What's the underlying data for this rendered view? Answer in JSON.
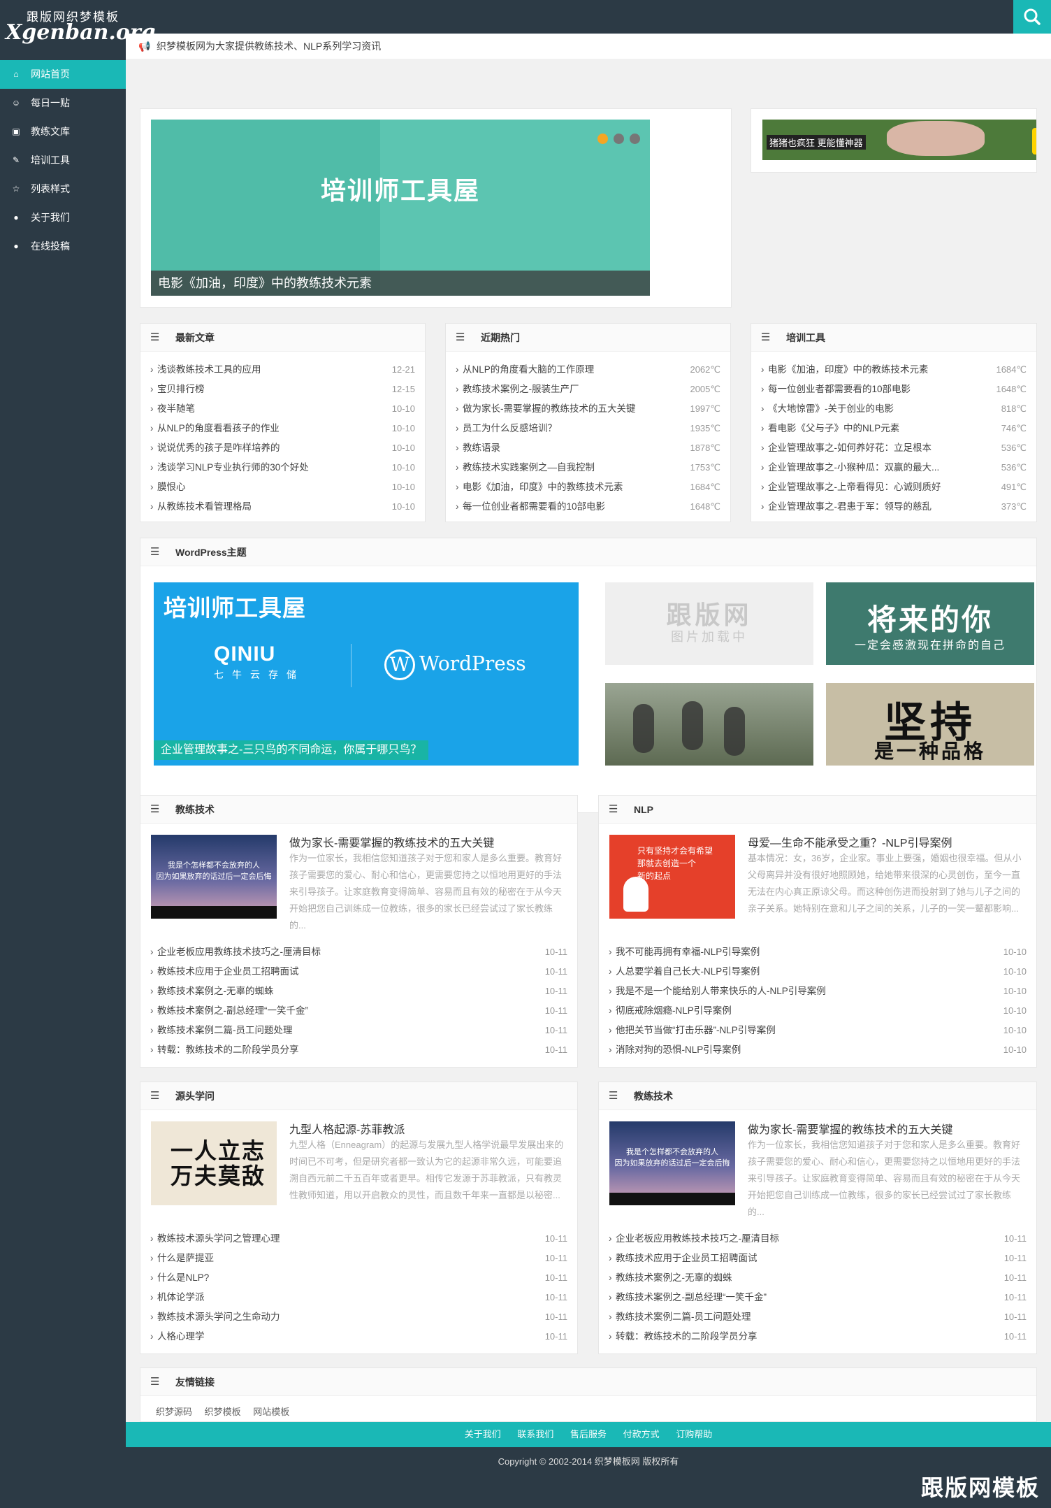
{
  "site": {
    "logo_top": "跟版网织梦模板",
    "logo_main": "Xgenban.org",
    "notice": "织梦模板网为大家提供教练技术、NLP系列学习资讯",
    "watermark": "跟版网模板"
  },
  "nav": [
    {
      "label": "网站首页",
      "icon": "home-icon",
      "active": true
    },
    {
      "label": "每日一贴",
      "icon": "smile-icon"
    },
    {
      "label": "教练文库",
      "icon": "image-icon"
    },
    {
      "label": "培训工具",
      "icon": "pencil-icon"
    },
    {
      "label": "列表样式",
      "icon": "star-icon"
    },
    {
      "label": "关于我们",
      "icon": "chat-icon"
    },
    {
      "label": "在线投稿",
      "icon": "chat-icon"
    }
  ],
  "slider": {
    "title": "培训师工具屋",
    "caption": "电影《加油，印度》中的教练技术元素"
  },
  "ad": {
    "text": "猪猪也疯狂 更能懂神器"
  },
  "lists": [
    {
      "title": "最新文章",
      "items": [
        {
          "t": "浅谈教练技术工具的应用",
          "d": "12-21"
        },
        {
          "t": "宝贝排行榜",
          "d": "12-15"
        },
        {
          "t": "夜半随笔",
          "d": "10-10"
        },
        {
          "t": "从NLP的角度看看孩子的作业",
          "d": "10-10"
        },
        {
          "t": "说说优秀的孩子是咋样培养的",
          "d": "10-10"
        },
        {
          "t": "浅谈学习NLP专业执行师的30个好处",
          "d": "10-10"
        },
        {
          "t": "膜恨心",
          "d": "10-10"
        },
        {
          "t": "从教练技术看管理格局",
          "d": "10-10"
        }
      ]
    },
    {
      "title": "近期热门",
      "items": [
        {
          "t": "从NLP的角度看大脑的工作原理",
          "d": "2062℃"
        },
        {
          "t": "教练技术案例之-服装生产厂",
          "d": "2005℃"
        },
        {
          "t": "做为家长-需要掌握的教练技术的五大关键",
          "d": "1997℃"
        },
        {
          "t": "员工为什么反感培训？",
          "d": "1935℃"
        },
        {
          "t": "教练语录",
          "d": "1878℃"
        },
        {
          "t": "教练技术实践案例之—自我控制",
          "d": "1753℃"
        },
        {
          "t": "电影《加油，印度》中的教练技术元素",
          "d": "1684℃"
        },
        {
          "t": "每一位创业者都需要看的10部电影",
          "d": "1648℃"
        }
      ]
    },
    {
      "title": "培训工具",
      "items": [
        {
          "t": "电影《加油，印度》中的教练技术元素",
          "d": "1684℃"
        },
        {
          "t": "每一位创业者都需要看的10部电影",
          "d": "1648℃"
        },
        {
          "t": "《大地惊雷》-关于创业的电影",
          "d": "818℃"
        },
        {
          "t": "看电影《父与子》中的NLP元素",
          "d": "746℃"
        },
        {
          "t": "企业管理故事之-如何养好花：立足根本",
          "d": "536℃"
        },
        {
          "t": "企业管理故事之-小猴种瓜：双赢的最大...",
          "d": "536℃"
        },
        {
          "t": "企业管理故事之-上帝看得见：心诚则质好",
          "d": "491℃"
        },
        {
          "t": "企业管理故事之-君患于军：领导的慈乱",
          "d": "373℃"
        }
      ]
    }
  ],
  "wordpress": {
    "title": "WordPress主题",
    "big_title": "培训师工具屋",
    "qiniu": "QINIU",
    "qiniu_sub": "七牛云存储",
    "wp_label": "WordPress",
    "caption": "企业管理故事之-三只鸟的不同命运，你属于哪只鸟？",
    "thumb1_big": "跟版网",
    "thumb1_small": "图片加载中",
    "thumb2_big": "将来的你",
    "thumb2_small": "一定会感激现在拼命的自己",
    "thumb4_big": "坚持",
    "thumb4_small": "是一种品格"
  },
  "sections": [
    {
      "title": "教练技术",
      "img": "sky",
      "img_text": "我是个怎样都不会放弃的人\n因为如果放弃的话过后一定会后悔",
      "feature_title": "做为家长-需要掌握的教练技术的五大关键",
      "feature_desc": "作为一位家长，我相信您知道孩子对于您和家人是多么重要。教育好孩子需要您的爱心、耐心和信心，更需要您持之以恒地用更好的手法来引导孩子。让家庭教育变得简单、容易而且有效的秘密在于从今天开始把您自己训练成一位教练，很多的家长已经尝试过了家长教练的...",
      "items": [
        {
          "t": "企业老板应用教练技术技巧之-厘清目标",
          "d": "10-11"
        },
        {
          "t": "教练技术应用于企业员工招聘面试",
          "d": "10-11"
        },
        {
          "t": "教练技术案例之-无辜的蜘蛛",
          "d": "10-11"
        },
        {
          "t": "教练技术案例之-副总经理“一笑千金”",
          "d": "10-11"
        },
        {
          "t": "教练技术案例二篇-员工问题处理",
          "d": "10-11"
        },
        {
          "t": "转载：教练技术的二阶段学员分享",
          "d": "10-11"
        }
      ]
    },
    {
      "title": "NLP",
      "img": "red",
      "img_text": "只有坚持才会有希望\n那就去创造一个\n新的起点",
      "feature_title": "母爱—生命不能承受之重？-NLP引导案例",
      "feature_desc": "基本情况：女，36岁，企业家。事业上要强，婚姻也很幸福。但从小父母离异并没有很好地照顾她，给她带来很深的心灵创伤，至今一直无法在内心真正原谅父母。而这种创伤进而投射到了她与儿子之间的亲子关系。她特别在意和儿子之间的关系，儿子的一笑一颦都影响...",
      "items": [
        {
          "t": "我不可能再拥有幸福-NLP引导案例",
          "d": "10-10"
        },
        {
          "t": "人总要学着自己长大-NLP引导案例",
          "d": "10-10"
        },
        {
          "t": "我是不是一个能给别人带来快乐的人-NLP引导案例",
          "d": "10-10"
        },
        {
          "t": "彻底戒除烟瘾-NLP引导案例",
          "d": "10-10"
        },
        {
          "t": "他把关节当做“打击乐器”-NLP引导案例",
          "d": "10-10"
        },
        {
          "t": "消除对狗的恐惧-NLP引导案例",
          "d": "10-10"
        }
      ]
    },
    {
      "title": "源头学问",
      "img": "paper",
      "img_text": "一人立志\n万夫莫敌",
      "feature_title": "九型人格起源-苏菲教派",
      "feature_desc": "九型人格（Enneagram）的起源与发展九型人格学说最早发展出来的时间已不可考，但是研究者都一致认为它的起源非常久远，可能要追溯自西元前二千五百年或者更早。相传它发源于苏菲教派，只有教灵性教师知道，用以开启教众的灵性，而且数千年来一直都是以秘密...",
      "items": [
        {
          "t": "教练技术源头学问之管理心理",
          "d": "10-11"
        },
        {
          "t": "什么是萨提亚",
          "d": "10-11"
        },
        {
          "t": "什么是NLP?",
          "d": "10-11"
        },
        {
          "t": "机体论学派",
          "d": "10-11"
        },
        {
          "t": "教练技术源头学问之生命动力",
          "d": "10-11"
        },
        {
          "t": "人格心理学",
          "d": "10-11"
        }
      ]
    },
    {
      "title": "教练技术",
      "img": "sky",
      "img_text": "我是个怎样都不会放弃的人\n因为如果放弃的话过后一定会后悔",
      "feature_title": "做为家长-需要掌握的教练技术的五大关键",
      "feature_desc": "作为一位家长，我相信您知道孩子对于您和家人是多么重要。教育好孩子需要您的爱心、耐心和信心，更需要您持之以恒地用更好的手法来引导孩子。让家庭教育变得简单、容易而且有效的秘密在于从今天开始把您自己训练成一位教练，很多的家长已经尝试过了家长教练的...",
      "items": [
        {
          "t": "企业老板应用教练技术技巧之-厘清目标",
          "d": "10-11"
        },
        {
          "t": "教练技术应用于企业员工招聘面试",
          "d": "10-11"
        },
        {
          "t": "教练技术案例之-无辜的蜘蛛",
          "d": "10-11"
        },
        {
          "t": "教练技术案例之-副总经理“一笑千金”",
          "d": "10-11"
        },
        {
          "t": "教练技术案例二篇-员工问题处理",
          "d": "10-11"
        },
        {
          "t": "转载：教练技术的二阶段学员分享",
          "d": "10-11"
        }
      ]
    }
  ],
  "links": {
    "title": "友情链接",
    "items": [
      "织梦源码",
      "织梦模板",
      "网站模板"
    ]
  },
  "footer": {
    "links": [
      "关于我们",
      "联系我们",
      "售后服务",
      "付款方式",
      "订购帮助"
    ],
    "copyright": "Copyright © 2002-2014 织梦模板网 版权所有"
  }
}
